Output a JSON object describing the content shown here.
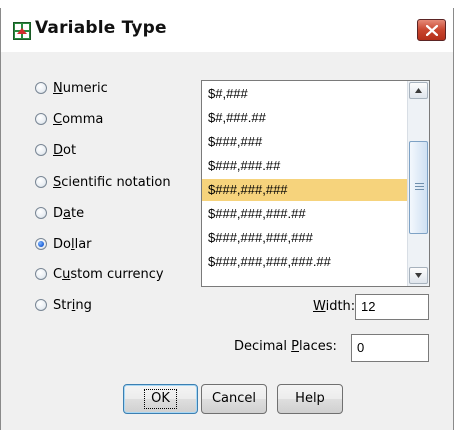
{
  "window": {
    "title": "Variable Type"
  },
  "radio_options": [
    {
      "pre": "",
      "acc": "N",
      "post": "umeric",
      "selected": false
    },
    {
      "pre": "",
      "acc": "C",
      "post": "omma",
      "selected": false
    },
    {
      "pre": "",
      "acc": "D",
      "post": "ot",
      "selected": false
    },
    {
      "pre": "",
      "acc": "S",
      "post": "cientific notation",
      "selected": false
    },
    {
      "pre": "D",
      "acc": "a",
      "post": "te",
      "selected": false
    },
    {
      "pre": "Do",
      "acc": "l",
      "post": "lar",
      "selected": true
    },
    {
      "pre": "C",
      "acc": "u",
      "post": "stom currency",
      "selected": false
    },
    {
      "pre": "Str",
      "acc": "i",
      "post": "ng",
      "selected": false
    }
  ],
  "format_list": {
    "items": [
      "$#,###",
      "$#,###.##",
      "$###,###",
      "$###,###.##",
      "$###,###,###",
      "$###,###,###.##",
      "$###,###,###,###",
      "$###,###,###,###.##"
    ],
    "selected_index": 4
  },
  "width": {
    "label_acc": "W",
    "label_post": "idth:",
    "value": "12"
  },
  "decimal_places": {
    "label_pre": "Decimal ",
    "label_acc": "P",
    "label_post": "laces:",
    "value": "0"
  },
  "buttons": {
    "ok": "OK",
    "cancel": "Cancel",
    "help": "Help"
  },
  "colors": {
    "selection": "#f6d37c",
    "close_button": "#c8452e",
    "radio_selected": "#1b5fd6"
  }
}
